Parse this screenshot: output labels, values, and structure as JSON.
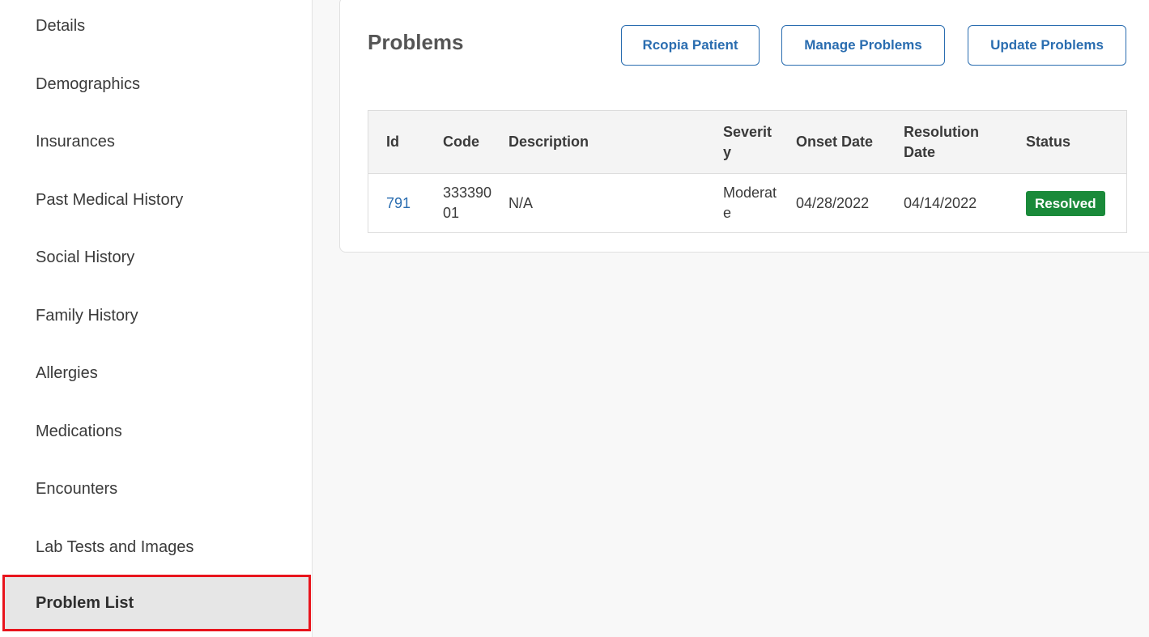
{
  "sidebar": {
    "items": [
      {
        "label": "Details"
      },
      {
        "label": "Demographics"
      },
      {
        "label": "Insurances"
      },
      {
        "label": "Past Medical History"
      },
      {
        "label": "Social History"
      },
      {
        "label": "Family History"
      },
      {
        "label": "Allergies"
      },
      {
        "label": "Medications"
      },
      {
        "label": "Encounters"
      },
      {
        "label": "Lab Tests and Images"
      },
      {
        "label": "Problem List"
      }
    ],
    "active_item": "Problem List"
  },
  "problems": {
    "title": "Problems",
    "buttons": {
      "rcopia_patient": "Rcopia Patient",
      "manage_problems": "Manage Problems",
      "update_problems": "Update Problems"
    },
    "table": {
      "columns": {
        "id": "Id",
        "code": "Code",
        "description": "Description",
        "severity": "Severity",
        "onset_date": "Onset Date",
        "resolution_date": "Resolution Date",
        "status": "Status"
      },
      "rows": [
        {
          "id": "791",
          "code": "33339001",
          "description": "N/A",
          "severity": "Moderate",
          "onset_date": "04/28/2022",
          "resolution_date": "04/14/2022",
          "status": "Resolved"
        }
      ]
    }
  },
  "colors": {
    "accent": "#2a6db0",
    "status_resolved": "#1a8a3a",
    "active_outline": "#e8141c"
  }
}
